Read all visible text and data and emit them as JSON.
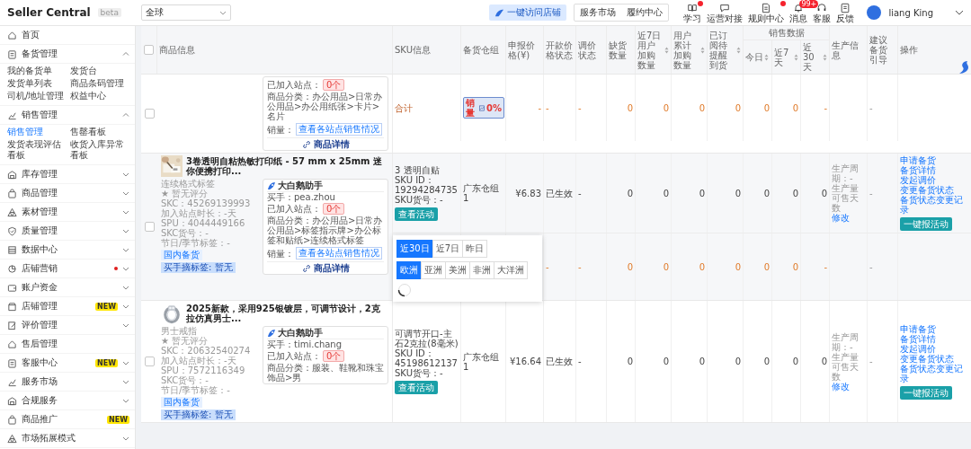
{
  "top_bar": {
    "brand": "Seller Central",
    "brand_badge": "beta",
    "region_select": "全球",
    "visit_store_button": "一键访问店铺",
    "nav_tabs": [
      "服务市场",
      "履约中心"
    ],
    "tools": [
      {
        "label": "学习",
        "notification": true
      },
      {
        "label": "运营对接",
        "notification": false
      },
      {
        "label": "规则中心",
        "notification": true
      },
      {
        "label": "消息",
        "notification": true,
        "badge": "99+"
      },
      {
        "label": "客服",
        "notification": false
      },
      {
        "label": "反馈",
        "notification": false
      }
    ],
    "user": "liang King"
  },
  "sidebar": {
    "items": [
      {
        "label": "首页",
        "kind": "link",
        "dot": false
      },
      {
        "label": "备货管理",
        "kind": "group",
        "expanded": true,
        "dot": false,
        "children": [
          {
            "label": "我的备货单",
            "selected": false
          },
          {
            "label": "发货台",
            "selected": false
          },
          {
            "label": "发货单列表",
            "selected": false
          },
          {
            "label": "商品条码管理",
            "selected": false
          },
          {
            "label": "司机/地址管理",
            "selected": false
          },
          {
            "label": "权益中心",
            "selected": false
          }
        ]
      },
      {
        "label": "销售管理",
        "kind": "group",
        "expanded": true,
        "dot": false,
        "children": [
          {
            "label": "销售管理",
            "selected": true
          },
          {
            "label": "售罄看板",
            "selected": false
          },
          {
            "label": "发货表现评估看板",
            "selected": false
          },
          {
            "label": "收货入库异常看板",
            "selected": false
          }
        ]
      },
      {
        "label": "库存管理",
        "kind": "group",
        "expanded": false,
        "dot": false
      },
      {
        "label": "商品管理",
        "kind": "group",
        "expanded": false,
        "dot": false
      },
      {
        "label": "素材管理",
        "kind": "group",
        "expanded": false,
        "dot": false
      },
      {
        "label": "质量管理",
        "kind": "group",
        "expanded": false,
        "dot": false
      },
      {
        "label": "数据中心",
        "kind": "group",
        "expanded": false,
        "dot": false
      },
      {
        "label": "店铺营销",
        "kind": "group",
        "expanded": false,
        "dot": true
      },
      {
        "label": "账户资金",
        "kind": "group",
        "expanded": false,
        "dot": false
      },
      {
        "label": "店铺管理",
        "kind": "group",
        "expanded": false,
        "dot": false,
        "badge": "NEW"
      },
      {
        "label": "评价管理",
        "kind": "group",
        "expanded": false,
        "dot": false
      },
      {
        "label": "售后管理",
        "kind": "link",
        "dot": false
      },
      {
        "label": "客服中心",
        "kind": "group",
        "expanded": false,
        "dot": false,
        "badge": "NEW"
      },
      {
        "label": "服务市场",
        "kind": "group",
        "expanded": false,
        "dot": false
      },
      {
        "label": "合规服务",
        "kind": "group",
        "expanded": false,
        "dot": false
      },
      {
        "label": "商品推广",
        "kind": "link",
        "dot": false,
        "badge": "NEW"
      },
      {
        "label": "市场拓展模式",
        "kind": "group",
        "expanded": false,
        "dot": false
      }
    ]
  },
  "table": {
    "header_checkbox": {
      "checked": false
    },
    "columns": [
      {
        "label": "商品信息",
        "sortable": false
      },
      {
        "label": "SKU信息",
        "sortable": false
      },
      {
        "label": "备货仓组",
        "sortable": false
      },
      {
        "label": "申报价格(¥)",
        "sortable": false
      },
      {
        "label": "开款价格状态",
        "sortable": false
      },
      {
        "label": "调价状态",
        "sortable": false
      },
      {
        "label": "缺货数量",
        "sortable": false
      },
      {
        "label": "近7日用户加购数量",
        "sortable": true
      },
      {
        "label": "用户累计加购数量",
        "sortable": true
      },
      {
        "label": "已订阅待提醒到货",
        "sortable": true
      },
      {
        "label": "销售数据",
        "children": [
          {
            "label": "今日",
            "sortable": true
          },
          {
            "label": "近7天",
            "sortable": true
          },
          {
            "label": "近30天",
            "sortable": true
          }
        ]
      },
      {
        "label": "生产信息",
        "sortable": false
      },
      {
        "label": "建议备货引导",
        "sortable": false
      },
      {
        "label": "操作",
        "sortable": false
      }
    ],
    "products": [
      {
        "checked": false,
        "helper": {
          "joined_label": "已加入站点：",
          "joined_value": "0个",
          "category": "商品分类：办公用品>日常办公用品>办公用纸张>卡片>名片",
          "sales_label": "销量：",
          "sales_button": "查看各站点销售情况",
          "detail_link": "商品详情"
        },
        "skus": [
          {
            "kind": "total",
            "label": "合计",
            "badge": {
              "label": "销量",
              "value": "0%"
            },
            "values": {
              "declared_price": "-",
              "price_status": "-",
              "adjust_status": "-",
              "out_of_stock": "0",
              "add_cart_7d": "0",
              "add_cart_total": "0",
              "subscribed": "0",
              "sales_today": "0",
              "sales_7d": "0",
              "sales_30d": "-"
            },
            "suggestion": "-"
          }
        ]
      },
      {
        "checked": false,
        "image": {
          "kind": "picture"
        },
        "title": "3卷透明自粘热敏打印纸 - 57 mm x 25mm 迷你便携打印...",
        "subtitle": "连续格式标签",
        "rating": "★ 暂无评分",
        "meta": [
          "SKC：45269139993",
          "加入站点时长：-天",
          "SPU：4044449166",
          "SKC货号：-",
          "节日/季节标签：-"
        ],
        "tags": [
          {
            "label": "国内备货",
            "kind": "plain"
          },
          {
            "label": "买手摘标签: 暂无",
            "kind": "strong"
          }
        ],
        "helper": {
          "title": "大白鹅助手",
          "buyer": "买手：pea.zhou",
          "joined_label": "已加入站点：",
          "joined_value": "0个",
          "category": "商品分类：办公用品>日常办公用品>标签指示牌>办公标签和贴纸>连续格式标签",
          "sales_label": "销量：",
          "sales_button": "查看各站点销售情况",
          "detail_link": "商品详情"
        },
        "skus": [
          {
            "kind": "sku",
            "name": "3 透明自贴",
            "sku_id": "SKU ID：19294284735",
            "sku_code": "SKU货号：-",
            "button": "查看活动",
            "values": {
              "warehouse": "广东仓组1",
              "declared_price": "¥6.83",
              "price_status": "已生效",
              "adjust_status": "-",
              "out_of_stock": "0",
              "add_cart_7d": "0",
              "add_cart_total": "0",
              "subscribed": "0",
              "sales_today": "0",
              "sales_7d": "0",
              "sales_30d": "0"
            },
            "production": {
              "cycle": "生产周期：-",
              "days": "生产量可售天数",
              "edit": "修改"
            },
            "suggestion": "-",
            "actions": {
              "links": [
                "申请备货",
                "备货详情",
                "发起调价",
                "变更备货状态",
                "备货状态变更记录"
              ],
              "button": "一键报活动"
            }
          },
          {
            "kind": "total",
            "values": {
              "price_status": "-",
              "adjust_status": "-",
              "out_of_stock": "0",
              "add_cart_7d": "0",
              "add_cart_total": "0",
              "subscribed": "0",
              "sales_today": "0",
              "sales_7d": "0",
              "sales_30d": "-"
            },
            "suggestion": "-",
            "popover": {
              "periods": [
                {
                  "label": "近30日",
                  "selected": true
                },
                {
                  "label": "近7日",
                  "selected": false
                },
                {
                  "label": "昨日",
                  "selected": false
                }
              ],
              "regions": [
                {
                  "label": "欧洲",
                  "selected": true
                },
                {
                  "label": "亚洲",
                  "selected": false
                },
                {
                  "label": "美洲",
                  "selected": false
                },
                {
                  "label": "非洲",
                  "selected": false
                },
                {
                  "label": "大洋洲",
                  "selected": false
                }
              ],
              "loading": true
            }
          }
        ]
      },
      {
        "checked": false,
        "image": {
          "kind": "picture"
        },
        "title": "2025新款，采用925银镀层，可调节设计，2克拉仿真男士...",
        "subtitle": "男士戒指",
        "rating": "★ 暂无评分",
        "meta": [
          "SKC：20632540274",
          "加入站点时长：-天",
          "SPU：7572116349",
          "SKC货号：-",
          "节日/季节标签：-"
        ],
        "tags": [
          {
            "label": "国内备货",
            "kind": "plain"
          },
          {
            "label": "买手摘标签: 暂无",
            "kind": "strong"
          }
        ],
        "helper": {
          "title": "大白鹅助手",
          "buyer": "买手：timi.chang",
          "joined_label": "已加入站点：",
          "joined_value": "0个",
          "category": "商品分类：服装、鞋靴和珠宝饰品>男"
        },
        "skus": [
          {
            "kind": "sku",
            "name": "可调节开口-主石2克拉(8毫米)",
            "sku_id": "SKU ID：45198612137",
            "sku_code": "SKU货号：-",
            "button": "查看活动",
            "values": {
              "warehouse": "广东仓组1",
              "declared_price": "¥16.64",
              "price_status": "已生效",
              "adjust_status": "-",
              "out_of_stock": "0",
              "add_cart_7d": "0",
              "add_cart_total": "0",
              "subscribed": "0",
              "sales_today": "0",
              "sales_7d": "0",
              "sales_30d": "0"
            },
            "production": {
              "cycle": "生产周期：-",
              "days": "生产量可售天数",
              "edit": "修改"
            },
            "suggestion": "-",
            "actions": {
              "links": [
                "申请备货",
                "备货详情",
                "发起调价",
                "变更备货状态",
                "备货状态变更记录"
              ],
              "button": "一键报活动"
            }
          }
        ]
      }
    ]
  }
}
